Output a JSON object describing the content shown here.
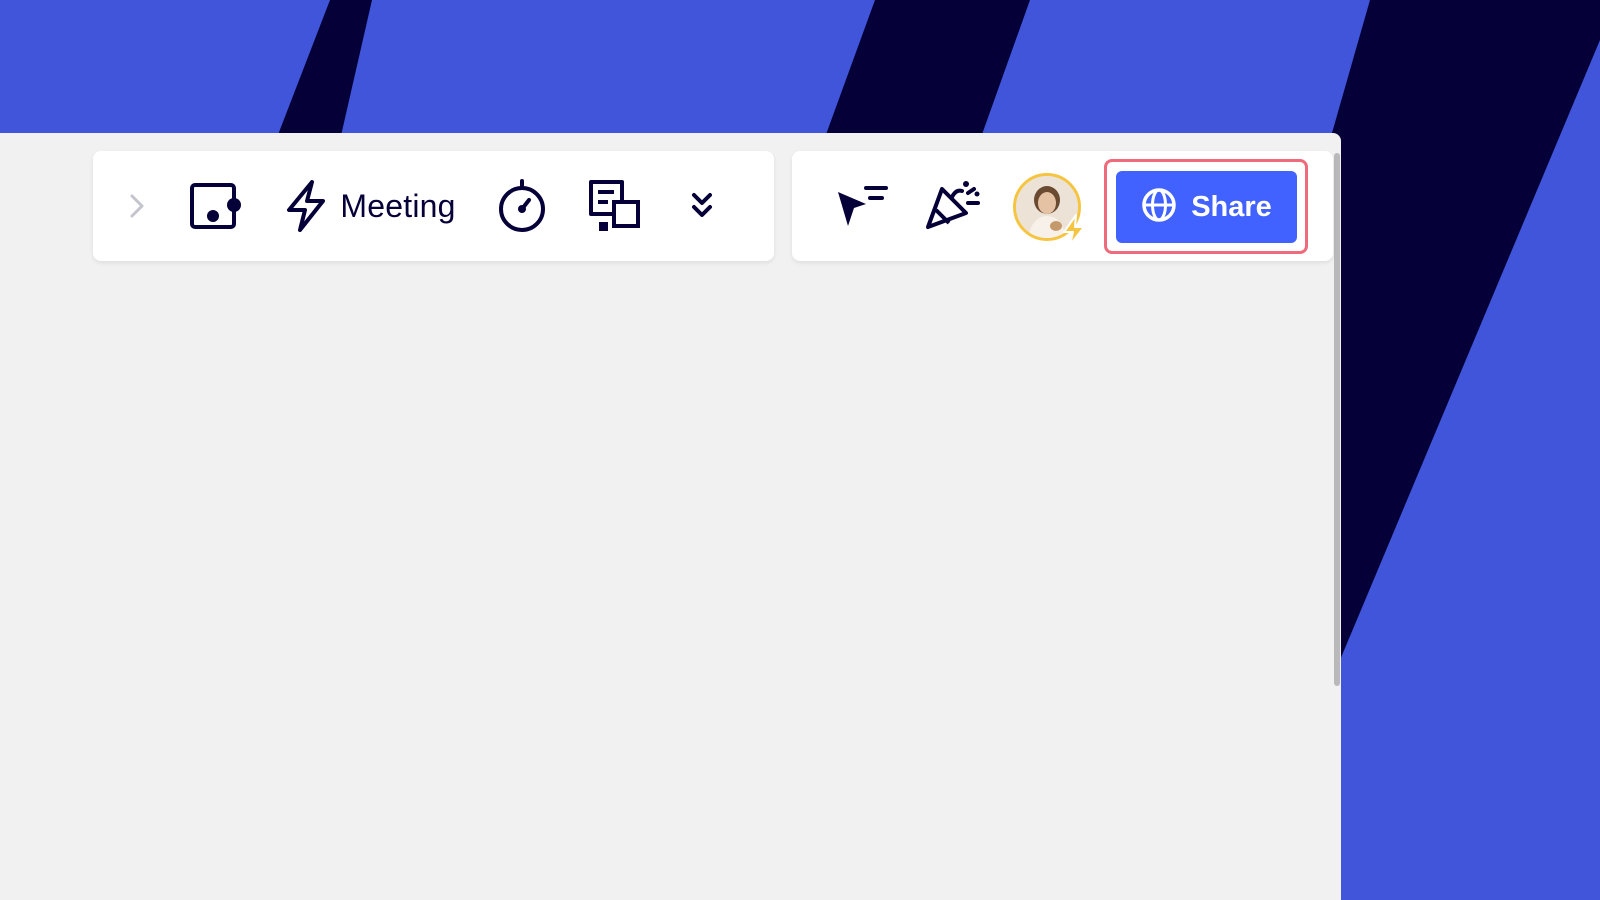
{
  "toolbar_left": {
    "meeting_label": "Meeting",
    "items": [
      "chevron-right-icon",
      "frame-icon",
      "lightning-icon",
      "timer-icon",
      "cards-icon",
      "double-chevron-down-icon"
    ]
  },
  "toolbar_right": {
    "share_label": "Share",
    "items": [
      "cursor-filter-icon",
      "celebrate-icon",
      "user-avatar",
      "globe-icon"
    ]
  },
  "colors": {
    "background": "#4055d9",
    "stripe": "#050038",
    "canvas": "#f1f1f1",
    "share_button": "#4262ff",
    "highlight": "#ef6b7c",
    "avatar_ring": "#f5c542"
  }
}
